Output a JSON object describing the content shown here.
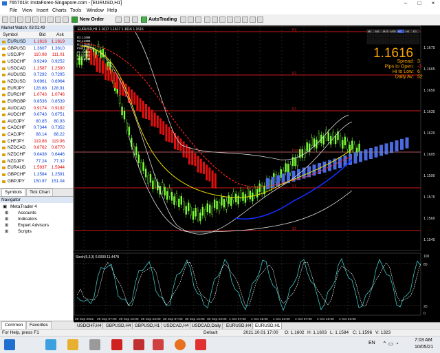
{
  "window": {
    "title": "7657019: InstaForex-Singapore.com - [EURUSD,H1]"
  },
  "menu": [
    "File",
    "View",
    "Insert",
    "Charts",
    "Tools",
    "Window",
    "Help"
  ],
  "toolbar": {
    "new_order": "New Order",
    "autotrading": "AutoTrading"
  },
  "market_watch": {
    "title": "Market Watch: 03:01:49",
    "headers": {
      "symbol": "Symbol",
      "bid": "Bid",
      "ask": "Ask"
    },
    "rows": [
      {
        "symbol": "EURUSD",
        "bid": "1.1616",
        "ask": "1.1619",
        "dir": "dn"
      },
      {
        "symbol": "GBPUSD",
        "bid": "1.3607",
        "ask": "1.3610",
        "dir": "up"
      },
      {
        "symbol": "USDJPY",
        "bid": "110.98",
        "ask": "111.01",
        "dir": "dn"
      },
      {
        "symbol": "USDCHF",
        "bid": "0.9249",
        "ask": "0.9252",
        "dir": "up"
      },
      {
        "symbol": "USDCAD",
        "bid": "1.2587",
        "ask": "1.2590",
        "dir": "dn"
      },
      {
        "symbol": "AUDUSD",
        "bid": "0.7292",
        "ask": "0.7295",
        "dir": "up"
      },
      {
        "symbol": "NZDUSD",
        "bid": "0.6961",
        "ask": "0.6964",
        "dir": "up"
      },
      {
        "symbol": "EURJPY",
        "bid": "128.88",
        "ask": "128.91",
        "dir": "up"
      },
      {
        "symbol": "EURCHF",
        "bid": "1.0743",
        "ask": "1.0746",
        "dir": "dn"
      },
      {
        "symbol": "EURGBP",
        "bid": "0.8536",
        "ask": "0.8539",
        "dir": "up"
      },
      {
        "symbol": "AUDCAD",
        "bid": "0.9174",
        "ask": "0.9182",
        "dir": "dn"
      },
      {
        "symbol": "AUDCHF",
        "bid": "0.6743",
        "ask": "0.6751",
        "dir": "up"
      },
      {
        "symbol": "AUDJPY",
        "bid": "80.85",
        "ask": "80.93",
        "dir": "up"
      },
      {
        "symbol": "CADCHF",
        "bid": "0.7344",
        "ask": "0.7352",
        "dir": "up"
      },
      {
        "symbol": "CADJPY",
        "bid": "88.14",
        "ask": "88.22",
        "dir": "up"
      },
      {
        "symbol": "CHFJPY",
        "bid": "119.88",
        "ask": "119.96",
        "dir": "dn"
      },
      {
        "symbol": "NZDCAD",
        "bid": "0.8762",
        "ask": "0.8770",
        "dir": "dn"
      },
      {
        "symbol": "NZDCHF",
        "bid": "0.6438",
        "ask": "0.6446",
        "dir": "up"
      },
      {
        "symbol": "NZDJPY",
        "bid": "77.24",
        "ask": "77.32",
        "dir": "up"
      },
      {
        "symbol": "EURAUD",
        "bid": "1.5937",
        "ask": "1.5944",
        "dir": "dn"
      },
      {
        "symbol": "GBPCHF",
        "bid": "1.2584",
        "ask": "1.2591",
        "dir": "up"
      },
      {
        "symbol": "GBPJPY",
        "bid": "150.97",
        "ask": "151.04",
        "dir": "up"
      }
    ],
    "tabs": [
      "Symbols",
      "Tick Chart"
    ]
  },
  "navigator": {
    "title": "Navigator",
    "root": "MetaTrader 4",
    "items": [
      "Accounts",
      "Indicators",
      "Expert Advisors",
      "Scripts"
    ],
    "tabs": [
      "Common",
      "Favorites"
    ]
  },
  "chart": {
    "header": "EURUSD,H1  1.1617 1.1617 1.1616 1.1616",
    "price": "1.1616",
    "stats": [
      {
        "label": "Spread:",
        "value": "3"
      },
      {
        "label": "Pips to Open:",
        "value": "-3"
      },
      {
        "label": "Hi to Low:",
        "value": "6"
      },
      {
        "label": "Daily Av:",
        "value": "52"
      }
    ],
    "timeframes": [
      "M1",
      "M5",
      "M15",
      "M30",
      "H1",
      "H4",
      "D1"
    ],
    "pivots": [
      "R3",
      "R2",
      "R1",
      "Pivot",
      "S1",
      "S2",
      "S3"
    ],
    "pivot_legend": [
      "R3 1.1698",
      "R2 1.1668",
      "R1 1.1645",
      "Pivot 1.1615",
      "S1 1.1592",
      "S2 1.1562",
      "S3 1.1539"
    ],
    "price_axis": [
      "1.1675",
      "1.1665",
      "1.1650",
      "1.1635",
      "1.1620",
      "1.1605",
      "1.1590",
      "1.1575",
      "1.1560",
      "1.1545"
    ],
    "stoch_label": "Stoch(5,3,3) 0.0000 11.4478",
    "stoch_axis": [
      "100",
      "80",
      "20",
      "0"
    ],
    "time_axis": [
      "28 Sep 2021",
      "29 Sep 07:00",
      "29 Sep 15:00",
      "29 Sep 23:00",
      "30 Sep 07:00",
      "30 Sep 15:00",
      "30 Sep 23:00",
      "1 Oct 07:00",
      "1 Oct 15:00",
      "1 Oct 23:00",
      "4 Oct 07:00",
      "4 Oct 15:00",
      "4 Oct 23:00"
    ]
  },
  "chart_tabs": [
    "USDCHF,H4",
    "GBPUSD,H4",
    "GBPUSD,H1",
    "USDCAD,H4",
    "USDCAD,Daily",
    "EURUSD,H4",
    "EURUSD,H1"
  ],
  "status": {
    "help": "For Help, press F1",
    "profile": "Default",
    "datetime": "2021.10.01 17:00",
    "open": "O: 1.1602",
    "high": "H: 1.1603",
    "low": "L: 1.1584",
    "close": "C: 1.1596",
    "volume": "V: 1323"
  },
  "taskbar": {
    "lang": "EN",
    "time": "7:03 AM",
    "date": "10/05/21"
  }
}
